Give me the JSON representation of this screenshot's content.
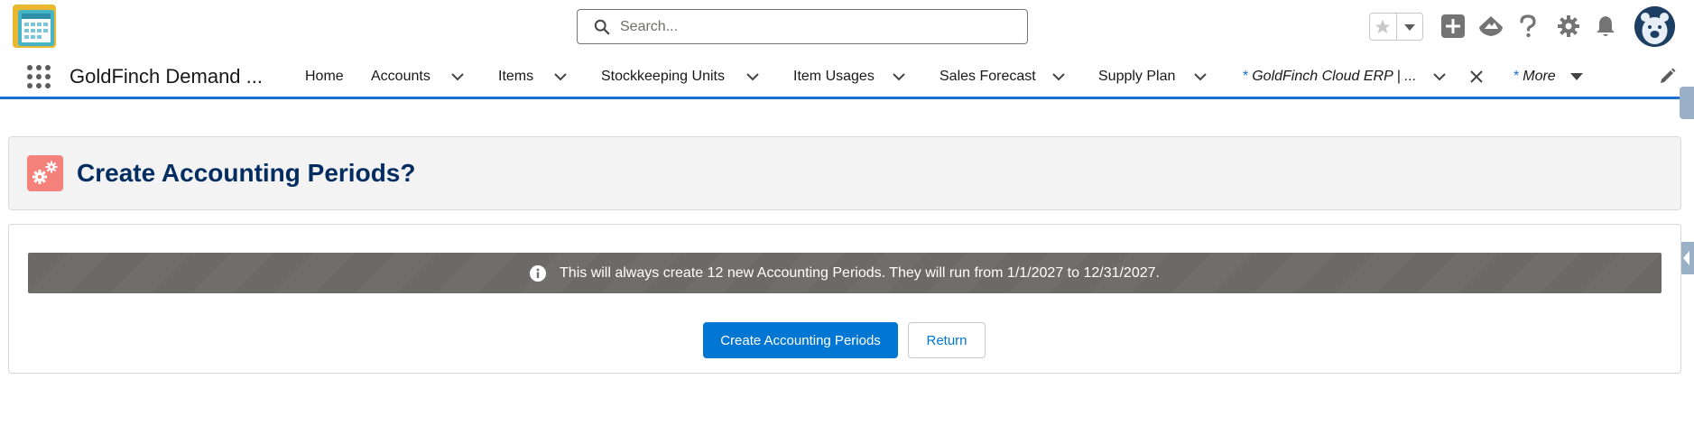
{
  "header": {
    "search": {
      "placeholder": "Search..."
    },
    "icons": [
      "favorites-star-icon",
      "favorites-dropdown-icon",
      "global-actions-plus-icon",
      "trailhead-icon",
      "help-icon",
      "setup-gear-icon",
      "notifications-bell-icon",
      "user-avatar"
    ]
  },
  "nav": {
    "app_name": "GoldFinch Demand ...",
    "items": [
      {
        "label": "Home"
      },
      {
        "label": "Accounts"
      },
      {
        "label": "Items"
      },
      {
        "label": "Stockkeeping Units"
      },
      {
        "label": "Item Usages"
      },
      {
        "label": "Sales Forecast"
      },
      {
        "label": "Supply Plan"
      },
      {
        "label": "GoldFinch Cloud ERP | ..."
      },
      {
        "label": "More"
      }
    ],
    "tab_marker": "*"
  },
  "page": {
    "title": "Create Accounting Periods?",
    "info_message": "This will always create 12 new Accounting Periods. They will run from 1/1/2027 to 12/31/2027.",
    "primary_button": "Create Accounting Periods",
    "secondary_button": "Return"
  },
  "colors": {
    "brand_blue": "#0176d3",
    "title_navy": "#032d60",
    "banner_gray": "#706e6b",
    "page_icon": "#f4817a",
    "nav_underline": "#1b6fce"
  }
}
